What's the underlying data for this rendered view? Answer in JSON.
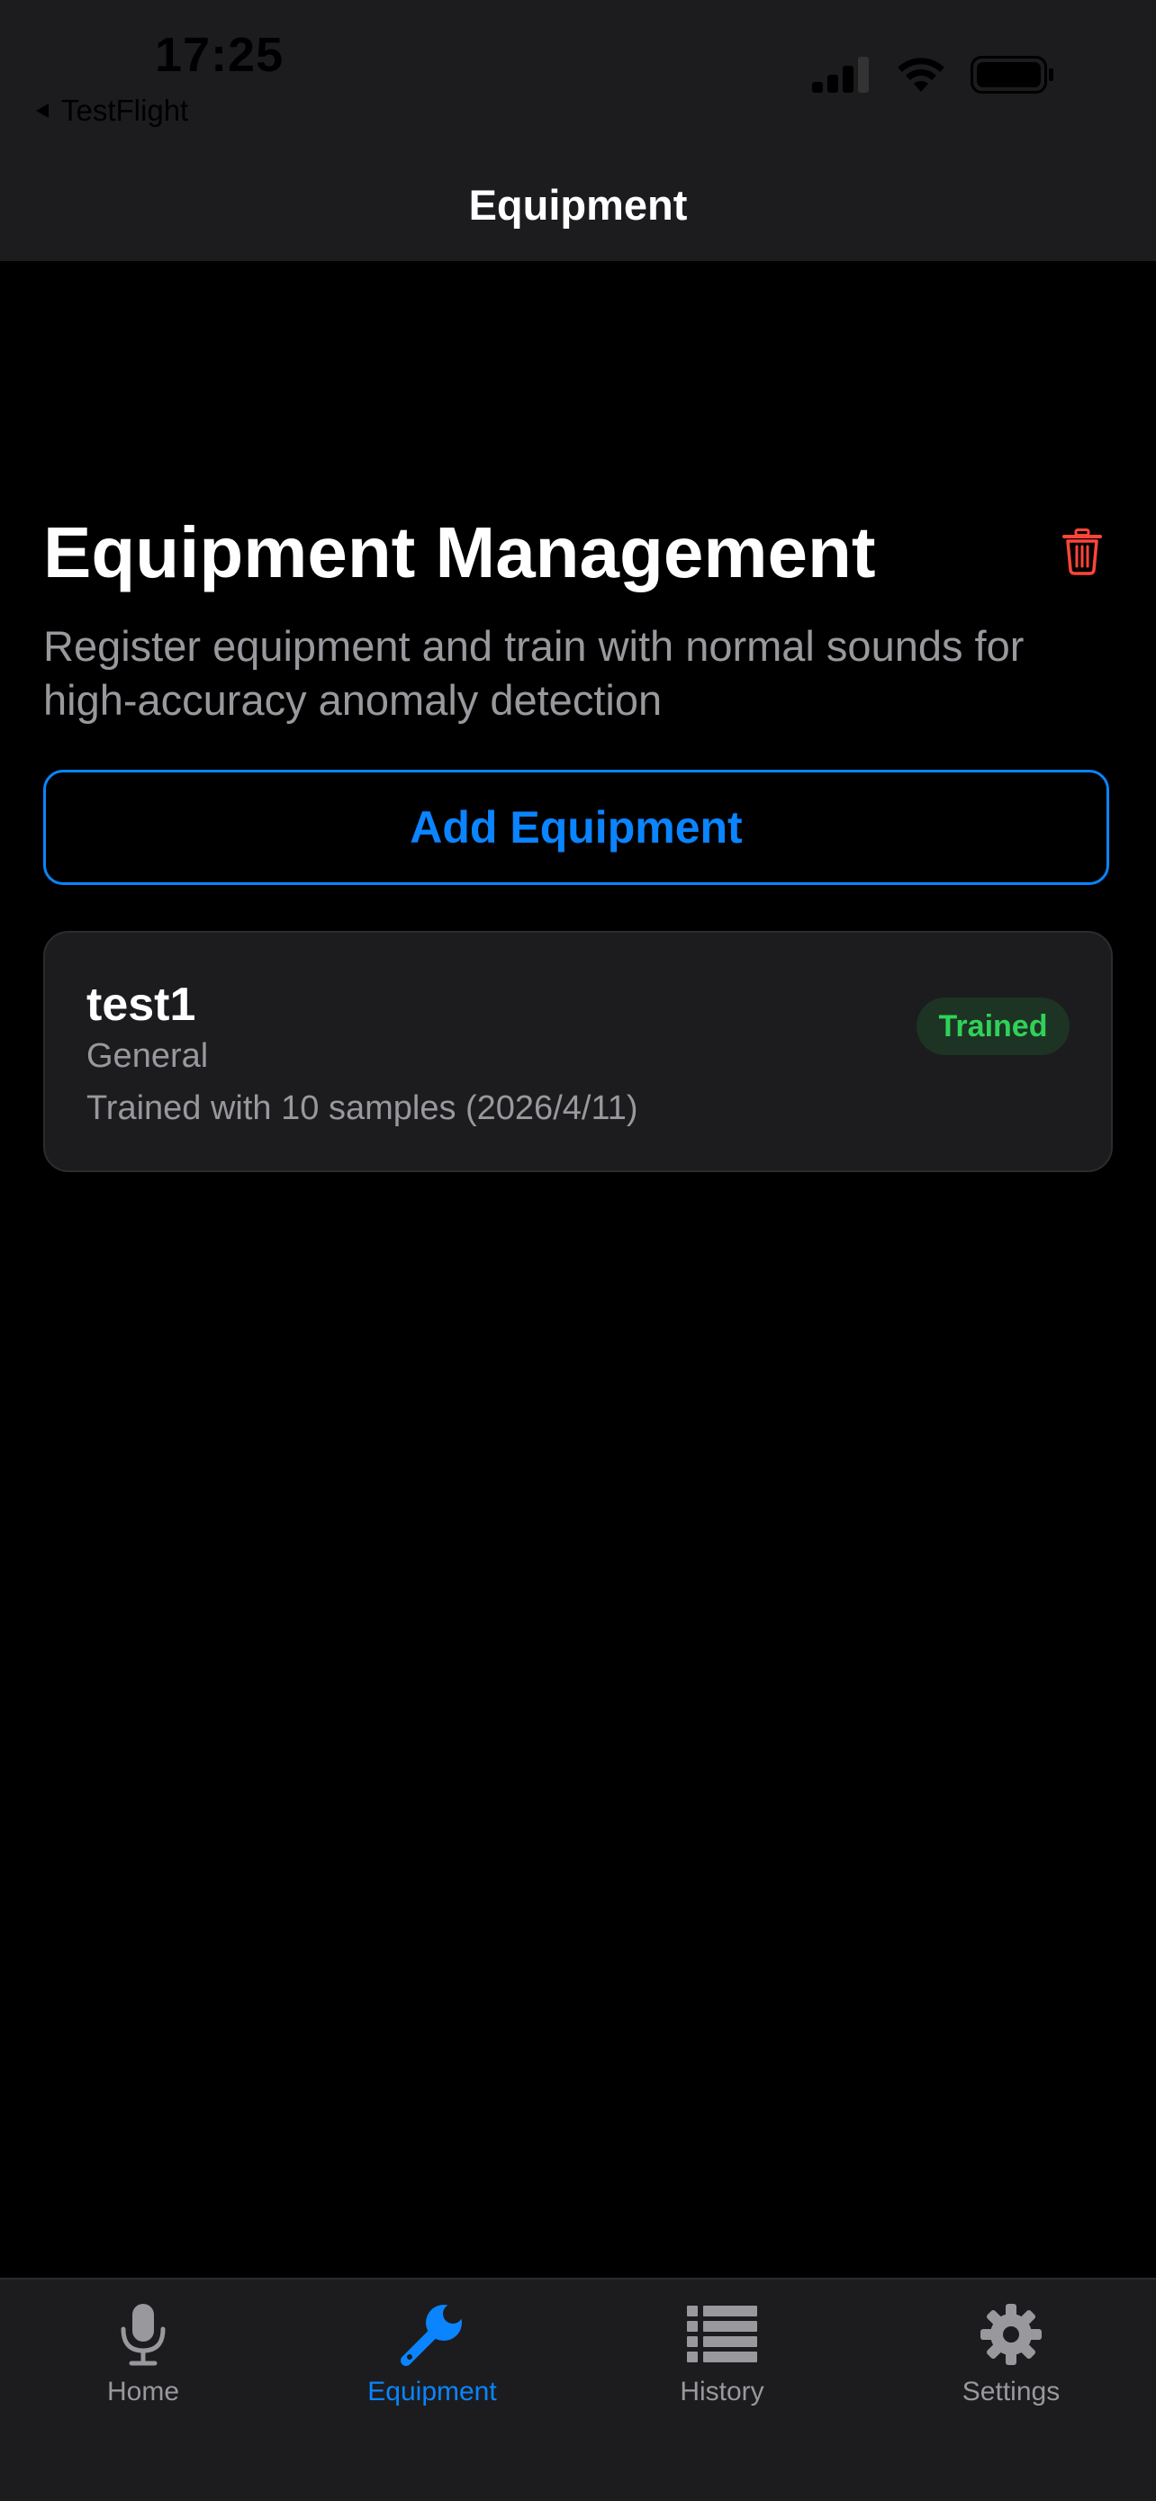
{
  "status_bar": {
    "time": "17:25",
    "back_app": "TestFlight"
  },
  "nav": {
    "title": "Equipment"
  },
  "header": {
    "title": "Equipment Management",
    "subtitle": "Register equipment and train with normal sounds for high-accuracy anomaly detection"
  },
  "actions": {
    "add_label": "Add Equipment"
  },
  "equipment": [
    {
      "name": "test1",
      "category": "General",
      "training": "Trained with 10 samples (2026/4/11)",
      "status": "Trained"
    }
  ],
  "tabs": [
    {
      "label": "Home",
      "icon": "microphone-icon"
    },
    {
      "label": "Equipment",
      "icon": "wrench-icon"
    },
    {
      "label": "History",
      "icon": "list-icon"
    },
    {
      "label": "Settings",
      "icon": "gear-icon"
    }
  ],
  "active_tab": "Equipment",
  "colors": {
    "accent": "#0a84ff",
    "success": "#30d158",
    "danger": "#ff453a",
    "background": "#000000",
    "surface": "#1c1c1e",
    "secondary_text": "#98989d"
  }
}
